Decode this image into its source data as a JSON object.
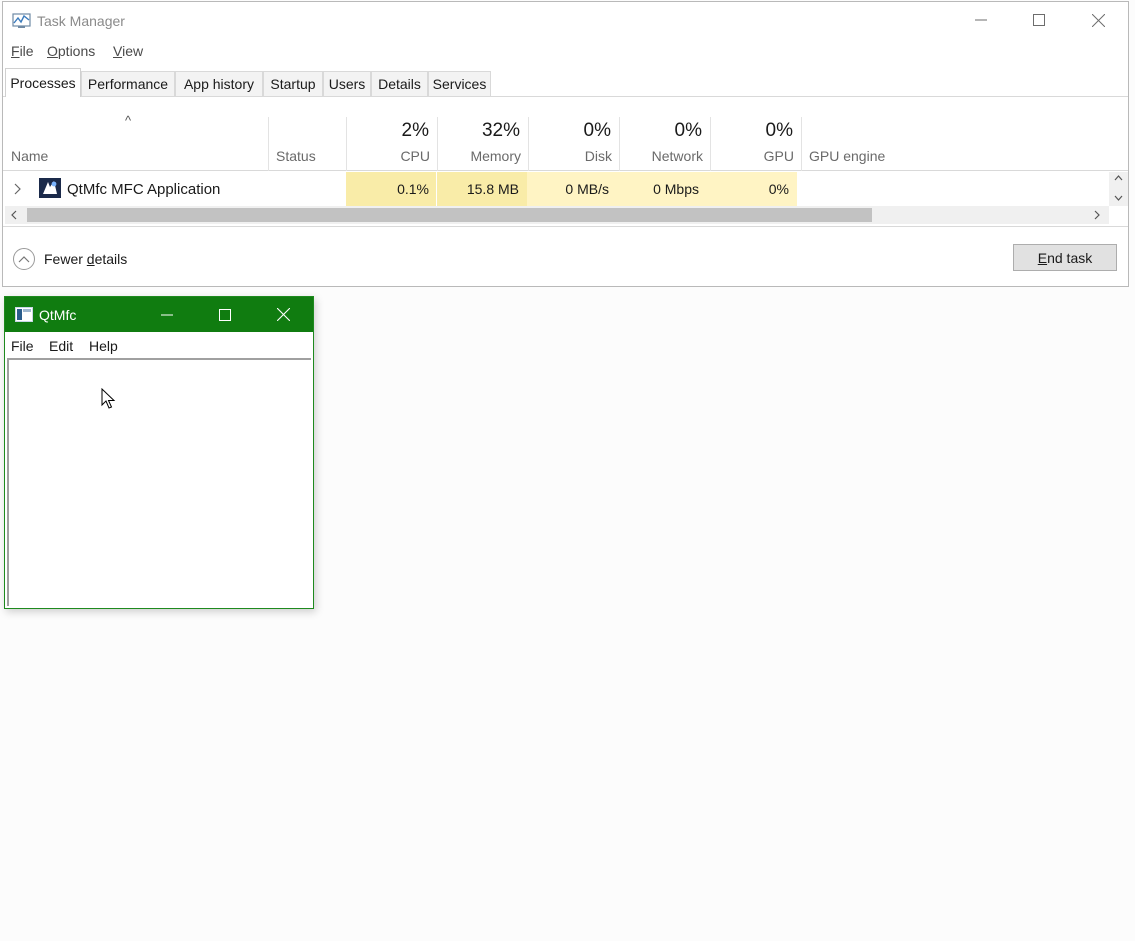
{
  "task_manager": {
    "title": "Task Manager",
    "menu": [
      {
        "label": "File",
        "accel": "F",
        "rest": "ile"
      },
      {
        "label": "Options",
        "accel": "O",
        "rest": "ptions"
      },
      {
        "label": "View",
        "accel": "V",
        "rest": "iew"
      }
    ],
    "tabs": [
      "Processes",
      "Performance",
      "App history",
      "Startup",
      "Users",
      "Details",
      "Services"
    ],
    "active_tab": "Processes",
    "columns": {
      "name": "Name",
      "status": "Status",
      "cpu": {
        "percent": "2%",
        "label": "CPU"
      },
      "memory": {
        "percent": "32%",
        "label": "Memory"
      },
      "disk": {
        "percent": "0%",
        "label": "Disk"
      },
      "network": {
        "percent": "0%",
        "label": "Network"
      },
      "gpu": {
        "percent": "0%",
        "label": "GPU"
      },
      "gpu_engine": "GPU engine"
    },
    "sort_indicator": "^",
    "process": {
      "name": "QtMfc MFC Application",
      "status": "",
      "cpu": "0.1%",
      "memory": "15.8 MB",
      "disk": "0 MB/s",
      "network": "0 Mbps",
      "gpu": "0%",
      "gpu_engine": ""
    },
    "footer": {
      "fewer_details": {
        "before": "Fewer ",
        "accel": "d",
        "after": "etails"
      },
      "end_task": {
        "accel": "E",
        "rest": "nd task"
      }
    },
    "colors": {
      "highlight": "#fff4c4",
      "highlight_strong": "#f9eca8"
    }
  },
  "qtmfc": {
    "title": "QtMfc",
    "menu": [
      "File",
      "Edit",
      "Help"
    ],
    "colors": {
      "titlebar": "#107c10"
    }
  }
}
